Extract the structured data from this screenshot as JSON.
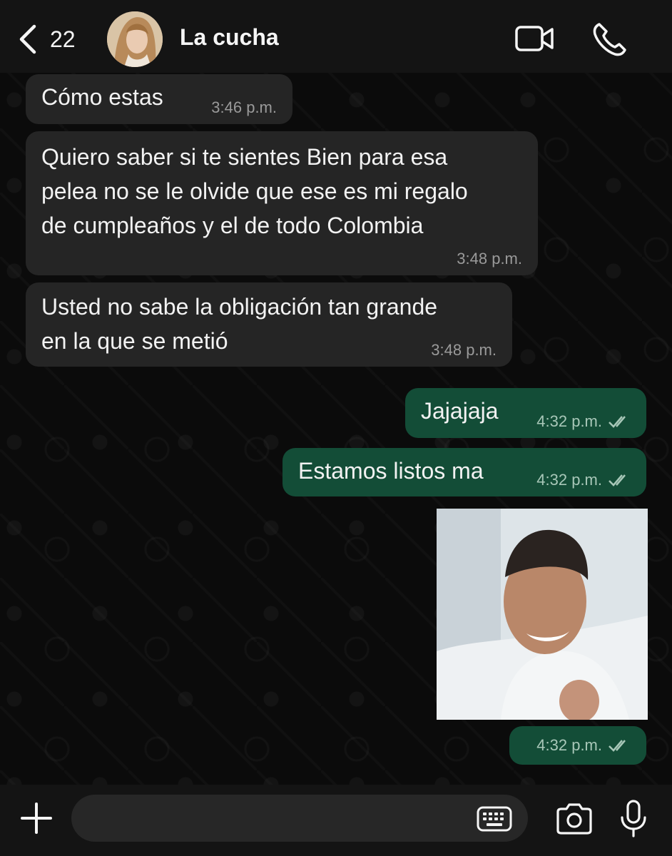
{
  "header": {
    "back_count": "22",
    "contact_name": "La cucha",
    "icons": {
      "back": "chevron-left-icon",
      "video": "video-call-icon",
      "phone": "phone-icon"
    }
  },
  "messages": [
    {
      "direction": "incoming",
      "text": "Cómo estas",
      "time": "3:46 p.m."
    },
    {
      "direction": "incoming",
      "text": "Quiero saber si te sientes Bien para esa\npelea no se le olvide que ese es mi regalo\nde cumpleaños y el de todo Colombia",
      "time": "3:48 p.m."
    },
    {
      "direction": "incoming",
      "text": "Usted no sabe la obligación tan grande\nen la que se metió",
      "time": "3:48 p.m."
    },
    {
      "direction": "outgoing",
      "text": "Jajajaja",
      "time": "4:32 p.m.",
      "status": "read"
    },
    {
      "direction": "outgoing",
      "text": "Estamos listos ma",
      "time": "4:32 p.m.",
      "status": "read"
    },
    {
      "direction": "outgoing",
      "type": "image",
      "time": "4:32 p.m.",
      "status": "read"
    }
  ],
  "footer": {
    "input_placeholder": "",
    "icons": {
      "add": "plus-icon",
      "keyboard": "keyboard-icon",
      "camera": "camera-icon",
      "mic": "microphone-icon"
    }
  },
  "colors": {
    "incoming_bubble": "#252525",
    "outgoing_bubble": "#134d37",
    "background": "#0b0b0b",
    "bar": "#141414",
    "read_ticks": "#a8c7b8"
  }
}
